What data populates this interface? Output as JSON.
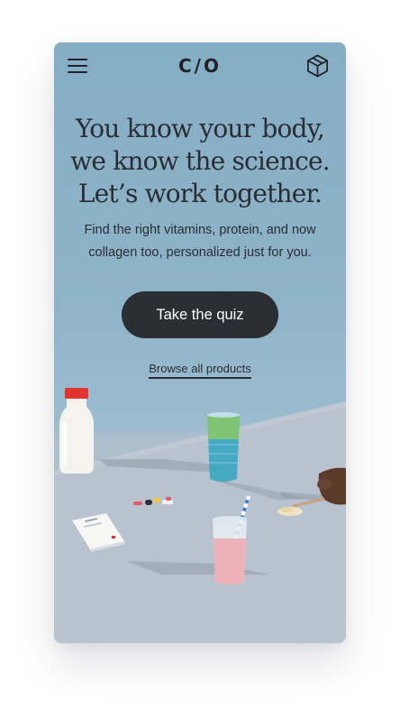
{
  "header": {
    "logo": "C/O",
    "menu_icon": "hamburger-menu-icon",
    "cart_icon": "package-box-icon"
  },
  "hero": {
    "headline_lines": [
      "You know your body,",
      "we know the science.",
      "Let’s work together."
    ],
    "subhead_lines": [
      "Find the right vitamins, protein, and now",
      "collagen too, personalized just for you."
    ],
    "cta_label": "Take the quiz",
    "browse_link": "Browse all products"
  },
  "colors": {
    "background_top": "#85adc4",
    "table_surface": "#b9c4cf",
    "button_bg": "#2b2e33",
    "button_text": "#ffffff",
    "text": "#2a2d31"
  }
}
